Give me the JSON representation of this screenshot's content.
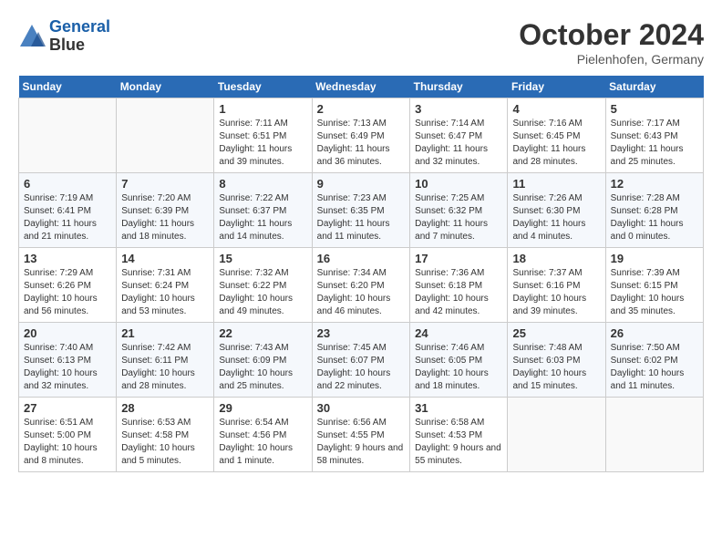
{
  "header": {
    "logo_line1": "General",
    "logo_line2": "Blue",
    "month": "October 2024",
    "location": "Pielenhofen, Germany"
  },
  "weekdays": [
    "Sunday",
    "Monday",
    "Tuesday",
    "Wednesday",
    "Thursday",
    "Friday",
    "Saturday"
  ],
  "weeks": [
    [
      {
        "num": "",
        "info": ""
      },
      {
        "num": "",
        "info": ""
      },
      {
        "num": "1",
        "info": "Sunrise: 7:11 AM\nSunset: 6:51 PM\nDaylight: 11 hours and 39 minutes."
      },
      {
        "num": "2",
        "info": "Sunrise: 7:13 AM\nSunset: 6:49 PM\nDaylight: 11 hours and 36 minutes."
      },
      {
        "num": "3",
        "info": "Sunrise: 7:14 AM\nSunset: 6:47 PM\nDaylight: 11 hours and 32 minutes."
      },
      {
        "num": "4",
        "info": "Sunrise: 7:16 AM\nSunset: 6:45 PM\nDaylight: 11 hours and 28 minutes."
      },
      {
        "num": "5",
        "info": "Sunrise: 7:17 AM\nSunset: 6:43 PM\nDaylight: 11 hours and 25 minutes."
      }
    ],
    [
      {
        "num": "6",
        "info": "Sunrise: 7:19 AM\nSunset: 6:41 PM\nDaylight: 11 hours and 21 minutes."
      },
      {
        "num": "7",
        "info": "Sunrise: 7:20 AM\nSunset: 6:39 PM\nDaylight: 11 hours and 18 minutes."
      },
      {
        "num": "8",
        "info": "Sunrise: 7:22 AM\nSunset: 6:37 PM\nDaylight: 11 hours and 14 minutes."
      },
      {
        "num": "9",
        "info": "Sunrise: 7:23 AM\nSunset: 6:35 PM\nDaylight: 11 hours and 11 minutes."
      },
      {
        "num": "10",
        "info": "Sunrise: 7:25 AM\nSunset: 6:32 PM\nDaylight: 11 hours and 7 minutes."
      },
      {
        "num": "11",
        "info": "Sunrise: 7:26 AM\nSunset: 6:30 PM\nDaylight: 11 hours and 4 minutes."
      },
      {
        "num": "12",
        "info": "Sunrise: 7:28 AM\nSunset: 6:28 PM\nDaylight: 11 hours and 0 minutes."
      }
    ],
    [
      {
        "num": "13",
        "info": "Sunrise: 7:29 AM\nSunset: 6:26 PM\nDaylight: 10 hours and 56 minutes."
      },
      {
        "num": "14",
        "info": "Sunrise: 7:31 AM\nSunset: 6:24 PM\nDaylight: 10 hours and 53 minutes."
      },
      {
        "num": "15",
        "info": "Sunrise: 7:32 AM\nSunset: 6:22 PM\nDaylight: 10 hours and 49 minutes."
      },
      {
        "num": "16",
        "info": "Sunrise: 7:34 AM\nSunset: 6:20 PM\nDaylight: 10 hours and 46 minutes."
      },
      {
        "num": "17",
        "info": "Sunrise: 7:36 AM\nSunset: 6:18 PM\nDaylight: 10 hours and 42 minutes."
      },
      {
        "num": "18",
        "info": "Sunrise: 7:37 AM\nSunset: 6:16 PM\nDaylight: 10 hours and 39 minutes."
      },
      {
        "num": "19",
        "info": "Sunrise: 7:39 AM\nSunset: 6:15 PM\nDaylight: 10 hours and 35 minutes."
      }
    ],
    [
      {
        "num": "20",
        "info": "Sunrise: 7:40 AM\nSunset: 6:13 PM\nDaylight: 10 hours and 32 minutes."
      },
      {
        "num": "21",
        "info": "Sunrise: 7:42 AM\nSunset: 6:11 PM\nDaylight: 10 hours and 28 minutes."
      },
      {
        "num": "22",
        "info": "Sunrise: 7:43 AM\nSunset: 6:09 PM\nDaylight: 10 hours and 25 minutes."
      },
      {
        "num": "23",
        "info": "Sunrise: 7:45 AM\nSunset: 6:07 PM\nDaylight: 10 hours and 22 minutes."
      },
      {
        "num": "24",
        "info": "Sunrise: 7:46 AM\nSunset: 6:05 PM\nDaylight: 10 hours and 18 minutes."
      },
      {
        "num": "25",
        "info": "Sunrise: 7:48 AM\nSunset: 6:03 PM\nDaylight: 10 hours and 15 minutes."
      },
      {
        "num": "26",
        "info": "Sunrise: 7:50 AM\nSunset: 6:02 PM\nDaylight: 10 hours and 11 minutes."
      }
    ],
    [
      {
        "num": "27",
        "info": "Sunrise: 6:51 AM\nSunset: 5:00 PM\nDaylight: 10 hours and 8 minutes."
      },
      {
        "num": "28",
        "info": "Sunrise: 6:53 AM\nSunset: 4:58 PM\nDaylight: 10 hours and 5 minutes."
      },
      {
        "num": "29",
        "info": "Sunrise: 6:54 AM\nSunset: 4:56 PM\nDaylight: 10 hours and 1 minute."
      },
      {
        "num": "30",
        "info": "Sunrise: 6:56 AM\nSunset: 4:55 PM\nDaylight: 9 hours and 58 minutes."
      },
      {
        "num": "31",
        "info": "Sunrise: 6:58 AM\nSunset: 4:53 PM\nDaylight: 9 hours and 55 minutes."
      },
      {
        "num": "",
        "info": ""
      },
      {
        "num": "",
        "info": ""
      }
    ]
  ]
}
